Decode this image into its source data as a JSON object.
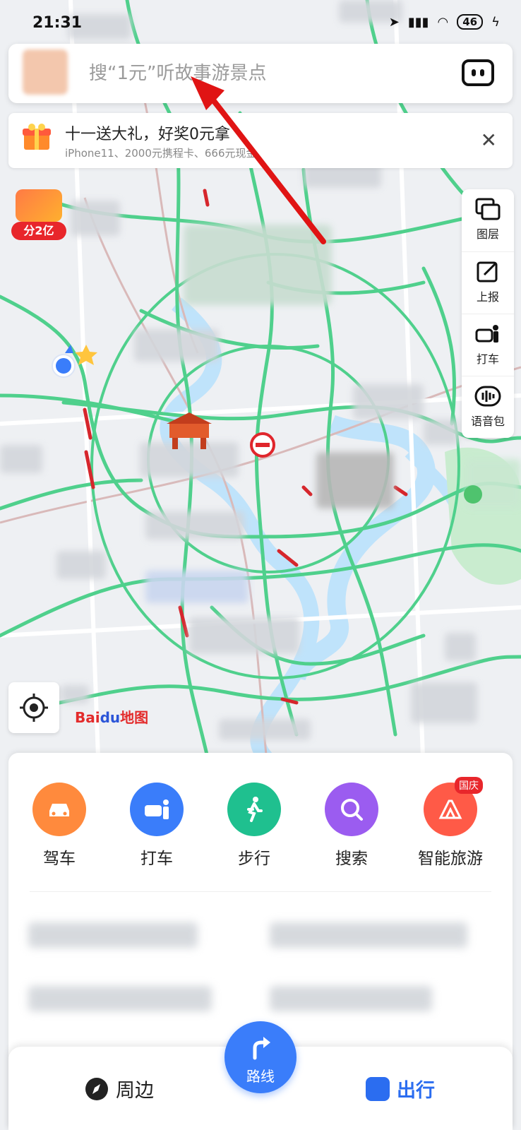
{
  "status_bar": {
    "time": "21:31",
    "battery": "46"
  },
  "search": {
    "placeholder": "搜“1元”听故事游景点"
  },
  "promo": {
    "title": "十一送大礼，好奖0元拿",
    "subtitle": "iPhone11、2000元携程卡、666元现金"
  },
  "red_packet": {
    "label": "分2亿"
  },
  "side_tools": [
    {
      "label": "图层",
      "icon": "layers-icon"
    },
    {
      "label": "上报",
      "icon": "report-icon"
    },
    {
      "label": "打车",
      "icon": "taxi-icon"
    },
    {
      "label": "语音包",
      "icon": "voice-pack-icon"
    }
  ],
  "brand": {
    "part1": "Bai",
    "part2": "du",
    "part3": "地图"
  },
  "quick_actions": [
    {
      "label": "驾车",
      "icon": "car-icon",
      "color": "#ff8a3d"
    },
    {
      "label": "打车",
      "icon": "taxi-icon",
      "color": "#3a7dfa"
    },
    {
      "label": "步行",
      "icon": "walk-icon",
      "color": "#1fc08f"
    },
    {
      "label": "搜索",
      "icon": "search-icon",
      "color": "#9b5cf0"
    },
    {
      "label": "智能旅游",
      "icon": "travel-icon",
      "color": "#ff5a47",
      "badge": "国庆"
    }
  ],
  "bottom_nav": {
    "nearby": "周边",
    "route": "路线",
    "trip": "出行"
  },
  "colors": {
    "road": "#4fd08c",
    "traffic_jam": "#d6262c",
    "river": "#bfe3fb",
    "accent": "#3a7dfa",
    "annotation": "#e01414"
  }
}
